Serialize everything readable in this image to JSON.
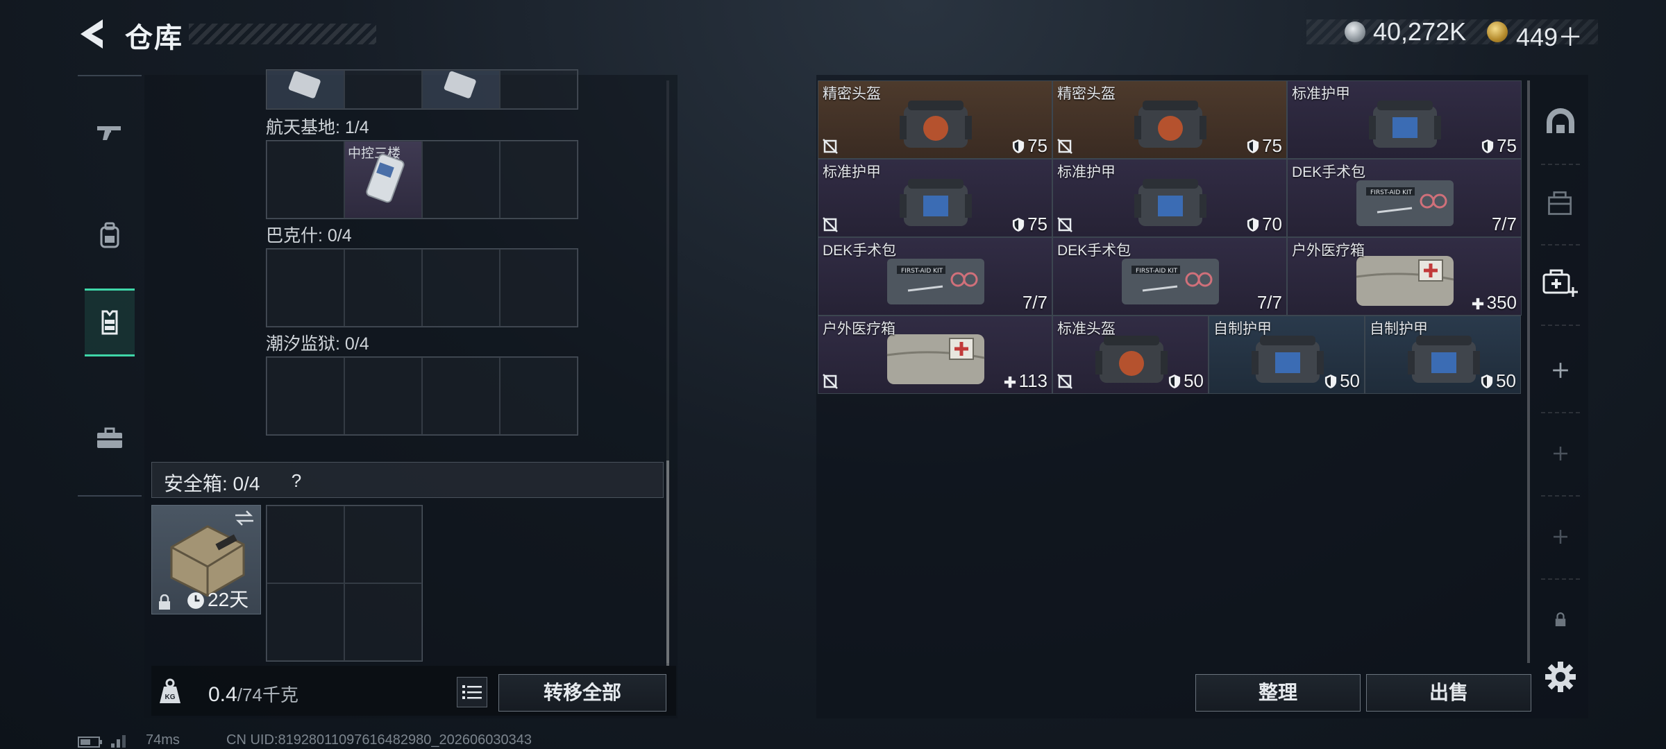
{
  "header": {
    "title": "仓库",
    "currency_silver": "40,272K",
    "currency_gold": "449＋"
  },
  "left_nav": {
    "items": [
      "gun-icon",
      "backpack-icon",
      "vest-icon",
      "toolbox-icon"
    ],
    "active": "vest-icon"
  },
  "containers": {
    "locations": [
      {
        "label": "航天基地: 1/4",
        "item_name": "中控三楼"
      },
      {
        "label": "巴克什: 0/4"
      },
      {
        "label": "潮汐监狱: 0/4"
      }
    ]
  },
  "safe_box": {
    "label": "安全箱: 0/4",
    "help": "?",
    "duration": "22天"
  },
  "footer": {
    "weight": "0.4",
    "capacity": "/74千克",
    "transfer_all": "转移全部"
  },
  "inventory": {
    "items": [
      {
        "name": "精密头盔",
        "value": "75",
        "rarity": "brown",
        "kind": "helmet-red"
      },
      {
        "name": "精密头盔",
        "value": "75",
        "rarity": "brown",
        "kind": "helmet-red"
      },
      {
        "name": "标准护甲",
        "value": "75",
        "rarity": "purple",
        "kind": "armor-blue"
      },
      {
        "name": "标准护甲",
        "value": "75",
        "rarity": "purple",
        "kind": "armor-blue"
      },
      {
        "name": "标准护甲",
        "value": "70",
        "rarity": "purple",
        "kind": "armor-blue"
      },
      {
        "name": "DEK手术包",
        "value": "7/7",
        "rarity": "purple",
        "kind": "surgical-kit"
      },
      {
        "name": "DEK手术包",
        "value": "7/7",
        "rarity": "purple",
        "kind": "surgical-kit"
      },
      {
        "name": "DEK手术包",
        "value": "7/7",
        "rarity": "purple",
        "kind": "surgical-kit"
      },
      {
        "name": "户外医疗箱",
        "value": "350",
        "rarity": "purple",
        "kind": "medic-box"
      },
      {
        "name": "户外医疗箱",
        "value": "113",
        "rarity": "purple",
        "kind": "medic-box"
      },
      {
        "name": "标准头盔",
        "value": "50",
        "rarity": "purple",
        "kind": "helmet-red"
      },
      {
        "name": "自制护甲",
        "value": "50",
        "rarity": "blue",
        "kind": "armor-blue"
      },
      {
        "name": "自制护甲",
        "value": "50",
        "rarity": "blue",
        "kind": "armor-blue"
      }
    ]
  },
  "actions": {
    "sort": "整理",
    "sell": "出售"
  },
  "status": {
    "ping": "74ms",
    "uid": "CN UID:8192801109761648​2980_202606030343"
  },
  "colors": {
    "accent": "#3fd6a8",
    "rarity_brown": "#4d3a2c",
    "rarity_purple": "#312c44",
    "rarity_blue": "#2a3a4c"
  }
}
